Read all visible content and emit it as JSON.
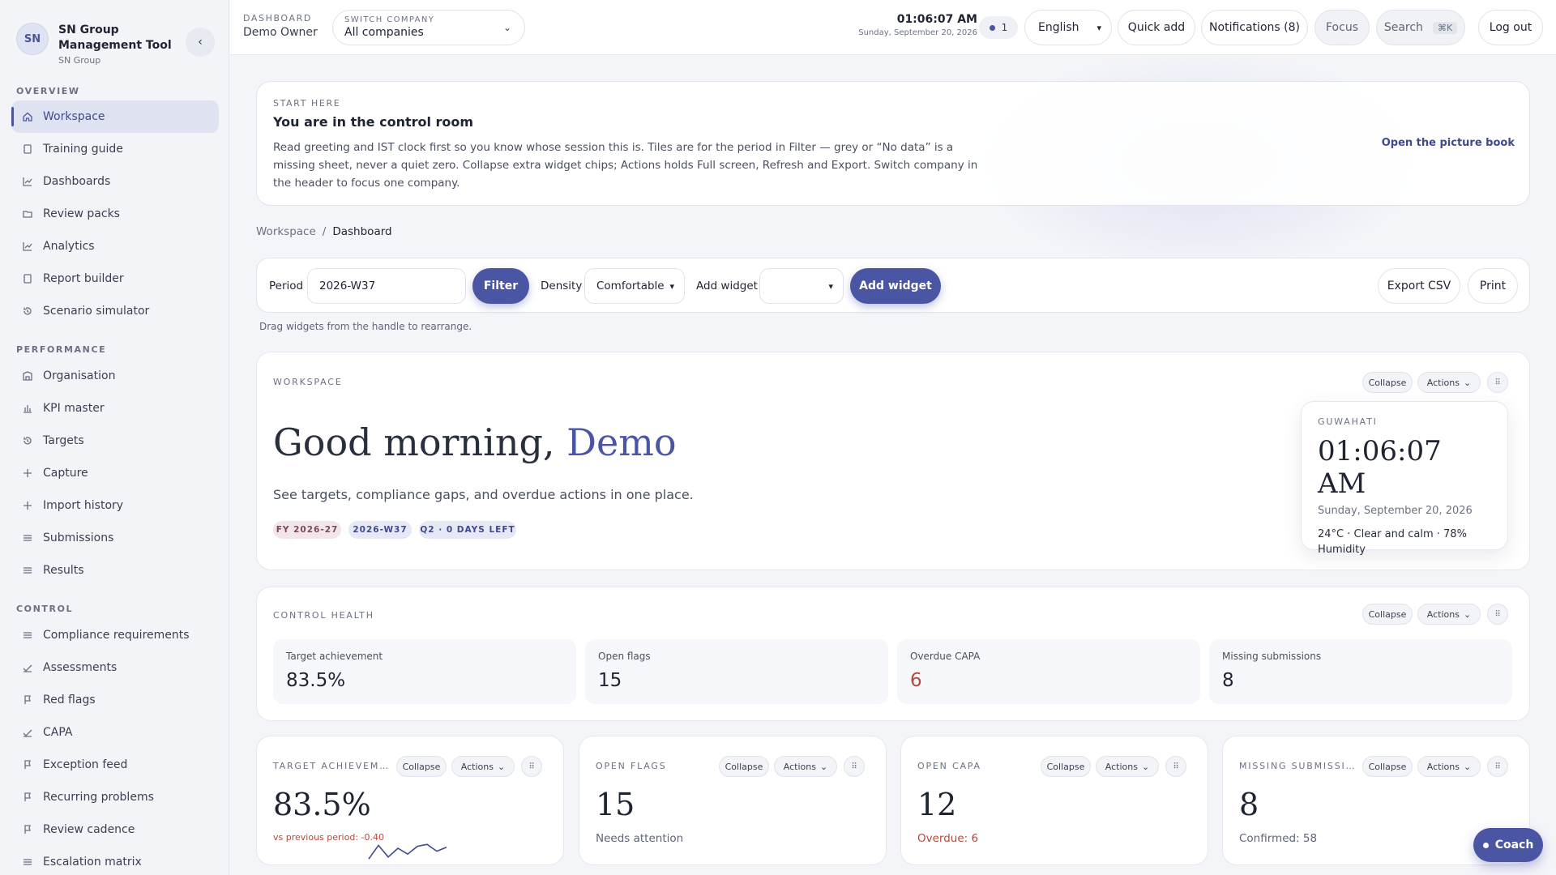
{
  "brand": {
    "initials": "SN",
    "title": "SN Group Management Tool",
    "subtitle": "SN Group"
  },
  "sidebar": {
    "sections": [
      {
        "label": "OVERVIEW",
        "items": [
          {
            "label": "Workspace",
            "icon": "home-icon",
            "active": true
          },
          {
            "label": "Training guide",
            "icon": "book-icon"
          },
          {
            "label": "Dashboards",
            "icon": "line-chart-icon"
          },
          {
            "label": "Review packs",
            "icon": "folder-icon"
          },
          {
            "label": "Analytics",
            "icon": "line-chart-icon"
          },
          {
            "label": "Report builder",
            "icon": "file-icon"
          },
          {
            "label": "Scenario simulator",
            "icon": "history-icon"
          }
        ]
      },
      {
        "label": "PERFORMANCE",
        "items": [
          {
            "label": "Organisation",
            "icon": "building-icon"
          },
          {
            "label": "KPI master",
            "icon": "bar-chart-icon"
          },
          {
            "label": "Targets",
            "icon": "history-icon"
          },
          {
            "label": "Capture",
            "icon": "plus-icon"
          },
          {
            "label": "Import history",
            "icon": "plus-icon"
          },
          {
            "label": "Submissions",
            "icon": "list-icon"
          },
          {
            "label": "Results",
            "icon": "list-icon"
          }
        ]
      },
      {
        "label": "CONTROL",
        "items": [
          {
            "label": "Compliance requirements",
            "icon": "list-icon"
          },
          {
            "label": "Assessments",
            "icon": "check-icon"
          },
          {
            "label": "Red flags",
            "icon": "flag-icon"
          },
          {
            "label": "CAPA",
            "icon": "check-icon"
          },
          {
            "label": "Exception feed",
            "icon": "flag-icon"
          },
          {
            "label": "Recurring problems",
            "icon": "flag-icon"
          },
          {
            "label": "Review cadence",
            "icon": "flag-icon"
          },
          {
            "label": "Escalation matrix",
            "icon": "list-icon"
          }
        ]
      }
    ]
  },
  "header": {
    "dashboard_label": "DASHBOARD",
    "owner": "Demo Owner",
    "company_label": "SWITCH COMPANY",
    "company_value": "All companies",
    "time": "01:06:07 AM",
    "date": "Sunday, September 20, 2026",
    "presence_count": "1",
    "language": "English",
    "quick_add": "Quick add",
    "notifications": "Notifications (8)",
    "focus": "Focus",
    "search": "Search",
    "search_kbd": "⌘K",
    "logout": "Log out"
  },
  "start": {
    "kicker": "START HERE",
    "title": "You are in the control room",
    "body": "Read greeting and IST clock first so you know whose session this is. Tiles are for the period in Filter — grey or “No data” is a missing sheet, never a quiet zero. Collapse extra widget chips; Actions holds Full screen, Refresh and Export. Switch company in the header to focus one company.",
    "link": "Open the picture book"
  },
  "breadcrumb": {
    "root": "Workspace",
    "sep": "/",
    "current": "Dashboard"
  },
  "toolbar": {
    "period_label": "Period",
    "period_value": "2026-W37",
    "filter": "Filter",
    "density_label": "Density",
    "density_value": "Comfortable",
    "add_widget_label": "Add widget",
    "add_widget_value": "",
    "add_widget_button": "Add widget",
    "export": "Export CSV",
    "print": "Print"
  },
  "hint": "Drag widgets from the handle to rearrange.",
  "widget_controls": {
    "collapse": "Collapse",
    "actions": "Actions",
    "handle": "⠿"
  },
  "workspace": {
    "kicker": "WORKSPACE",
    "greeting": "Good morning, ",
    "name": "Demo",
    "subtitle": "See targets, compliance gaps, and overdue actions in one place.",
    "tags": [
      "FY 2026-27",
      "2026-W37",
      "Q2 · 0 DAYS LEFT"
    ],
    "clock": {
      "city": "GUWAHATI",
      "time": "01:06:07 AM",
      "date": "Sunday, September 20, 2026",
      "weather": "24°C · Clear and calm · 78% Humidity"
    }
  },
  "control_health": {
    "kicker": "CONTROL HEALTH",
    "metrics": [
      {
        "label": "Target achievement",
        "value": "83.5%"
      },
      {
        "label": "Open flags",
        "value": "15"
      },
      {
        "label": "Overdue CAPA",
        "value": "6"
      },
      {
        "label": "Missing submissions",
        "value": "8"
      }
    ]
  },
  "tiles": [
    {
      "kicker": "TARGET ACHIEVEMENT",
      "value": "83.5%",
      "delta": "vs previous period: -0.40",
      "sparkline": [
        0.2,
        0.9,
        0.3,
        0.75,
        0.45,
        0.85,
        0.95,
        0.6,
        0.8
      ]
    },
    {
      "kicker": "OPEN FLAGS",
      "value": "15",
      "sub": "Needs attention"
    },
    {
      "kicker": "OPEN CAPA",
      "value": "12",
      "sub": "Overdue: 6"
    },
    {
      "kicker": "MISSING SUBMISSIONS",
      "value": "8",
      "sub": "Confirmed: 58"
    }
  ],
  "coach": "Coach",
  "colors": {
    "accent": "#4a56a3",
    "danger": "#b14a3c"
  }
}
